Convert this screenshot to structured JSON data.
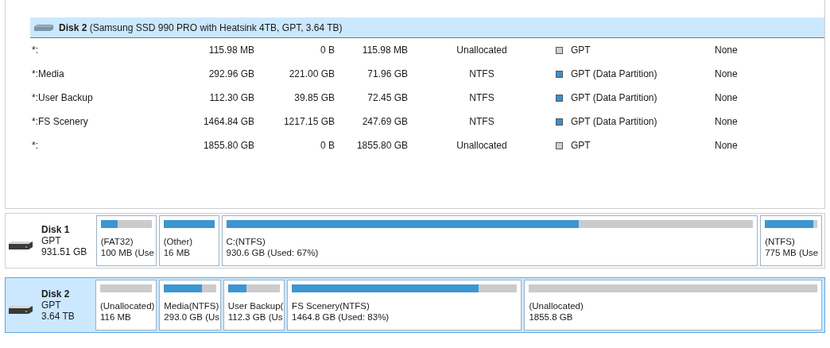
{
  "volume_list": {
    "disk_header": {
      "name": "Disk 2",
      "details": "(Samsung SSD 990 PRO with Heatsink 4TB, GPT, 3.64 TB)",
      "selected": true
    },
    "rows": [
      {
        "partition": "*:",
        "capacity": "115.98 MB",
        "used": "0 B",
        "unused": "115.98 MB",
        "file_system": "Unallocated",
        "type": "GPT",
        "color": "#d0d0d0",
        "status": "None"
      },
      {
        "partition": "*:Media",
        "capacity": "292.96 GB",
        "used": "221.00 GB",
        "unused": "71.96 GB",
        "file_system": "NTFS",
        "type": "GPT (Data Partition)",
        "color": "#3a8fd0",
        "status": "None"
      },
      {
        "partition": "*:User Backup",
        "capacity": "112.30 GB",
        "used": "39.85 GB",
        "unused": "72.45 GB",
        "file_system": "NTFS",
        "type": "GPT (Data Partition)",
        "color": "#3a8fd0",
        "status": "None"
      },
      {
        "partition": "*:FS Scenery",
        "capacity": "1464.84 GB",
        "used": "1217.15 GB",
        "unused": "247.69 GB",
        "file_system": "NTFS",
        "type": "GPT (Data Partition)",
        "color": "#3a8fd0",
        "status": "None"
      },
      {
        "partition": "*:",
        "capacity": "1855.80 GB",
        "used": "0 B",
        "unused": "1855.80 GB",
        "file_system": "Unallocated",
        "type": "GPT",
        "color": "#d0d0d0",
        "status": "None"
      }
    ]
  },
  "disk_map": [
    {
      "name": "Disk 1",
      "style": "GPT",
      "size": "931.51 GB",
      "selected": false,
      "partitions": [
        {
          "label": "(FAT32)",
          "info": "100 MB (Use",
          "level": 0.33
        },
        {
          "label": "(Other)",
          "info": "16 MB",
          "level": 1
        },
        {
          "label": "C:(NTFS)",
          "info": "930.6 GB (Used: 67%)",
          "level": 0.67
        },
        {
          "label": "(NTFS)",
          "info": "775 MB (Use",
          "level": 0.93
        }
      ]
    },
    {
      "name": "Disk 2",
      "style": "GPT",
      "size": "3.64 TB",
      "selected": true,
      "partitions": [
        {
          "label": "(Unallocated)",
          "info": "116 MB",
          "level": 0
        },
        {
          "label": "Media(NTFS)",
          "info": "293.0 GB (Us",
          "level": 0.73
        },
        {
          "label": "User Backup(",
          "info": "112.3 GB (Us",
          "level": 0.35
        },
        {
          "label": "FS Scenery(NTFS)",
          "info": "1464.8 GB (Used: 83%)",
          "level": 0.83
        },
        {
          "label": "(Unallocated)",
          "info": "1855.8 GB",
          "level": 0
        }
      ]
    }
  ]
}
